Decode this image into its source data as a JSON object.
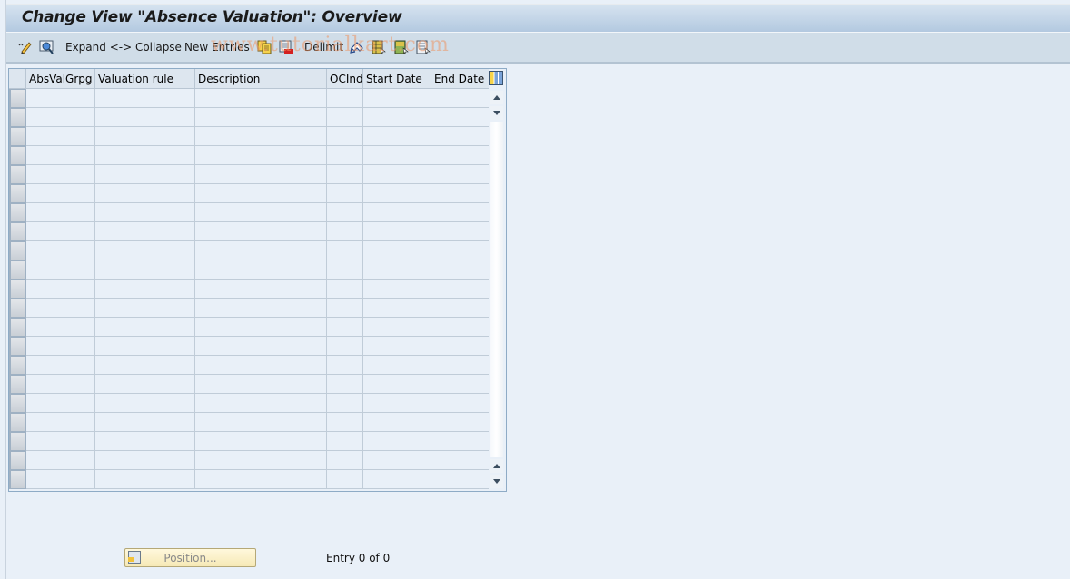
{
  "window": {
    "title": "Change View \"Absence Valuation\": Overview"
  },
  "toolbar": {
    "items": [
      {
        "type": "icon",
        "icon": "display-change-icon",
        "label": ""
      },
      {
        "type": "icon",
        "icon": "find-icon",
        "label": ""
      },
      {
        "type": "text",
        "label": "Expand <-> Collapse"
      },
      {
        "type": "text",
        "label": "New Entries"
      },
      {
        "type": "icon",
        "icon": "copy-as-icon",
        "label": ""
      },
      {
        "type": "icon",
        "icon": "delete-icon",
        "label": ""
      },
      {
        "type": "text",
        "label": "Delimit"
      },
      {
        "type": "icon",
        "icon": "undo-change-icon",
        "label": ""
      },
      {
        "type": "icon",
        "icon": "select-all-icon",
        "label": ""
      },
      {
        "type": "icon",
        "icon": "select-block-icon",
        "label": ""
      },
      {
        "type": "icon",
        "icon": "deselect-all-icon",
        "label": ""
      }
    ],
    "expand_collapse_label": "Expand <-> Collapse",
    "new_entries_label": "New Entries",
    "delimit_label": "Delimit"
  },
  "watermark": "www.tutorialkart.com",
  "table": {
    "columns": [
      {
        "key": "absvalgrpg",
        "label": "AbsValGrpg"
      },
      {
        "key": "valuation_rule",
        "label": "Valuation rule"
      },
      {
        "key": "description",
        "label": "Description"
      },
      {
        "key": "ocind",
        "label": "OCInd"
      },
      {
        "key": "start_date",
        "label": "Start Date"
      },
      {
        "key": "end_date",
        "label": "End Date"
      }
    ],
    "rows": [],
    "visible_empty_rows": 21
  },
  "footer": {
    "position_button_label": "Position...",
    "entry_text": "Entry 0 of 0"
  }
}
